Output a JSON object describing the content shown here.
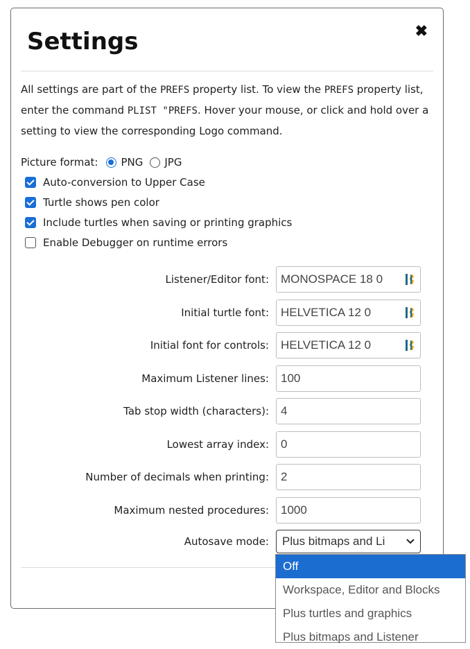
{
  "dialog": {
    "title": "Settings",
    "close": "✖"
  },
  "description": {
    "t1": "All settings are part of the ",
    "m1": "PREFS",
    "t2": " property list. To view the ",
    "m2": "PREFS",
    "t3": " property list, enter the command ",
    "m3": "PLIST \"PREFS",
    "t4": ". Hover your mouse, or click and hold over a setting to view the corresponding Logo command."
  },
  "picture_format": {
    "label": "Picture format:",
    "options": [
      "PNG",
      "JPG"
    ],
    "selected": "PNG"
  },
  "checkboxes": [
    {
      "label": "Auto-conversion to Upper Case",
      "checked": true
    },
    {
      "label": "Turtle shows pen color",
      "checked": true
    },
    {
      "label": "Include turtles when saving or printing graphics",
      "checked": true
    },
    {
      "label": "Enable Debugger on runtime errors",
      "checked": false
    }
  ],
  "fields": [
    {
      "label": "Listener/Editor font:",
      "value": "MONOSPACE 18 0",
      "icon": "font-picker-icon"
    },
    {
      "label": "Initial turtle font:",
      "value": "HELVETICA 12 0",
      "icon": "font-picker-icon"
    },
    {
      "label": "Initial font for controls:",
      "value": "HELVETICA 12 0",
      "icon": "font-picker-icon"
    },
    {
      "label": "Maximum Listener lines:",
      "value": "100"
    },
    {
      "label": "Tab stop width (characters):",
      "value": "4"
    },
    {
      "label": "Lowest array index:",
      "value": "0"
    },
    {
      "label": "Number of decimals when printing:",
      "value": "2"
    },
    {
      "label": "Maximum nested procedures:",
      "value": "1000"
    }
  ],
  "autosave": {
    "label": "Autosave mode:",
    "value": "Plus bitmaps and Li",
    "options": [
      "Off",
      "Workspace, Editor and Blocks",
      "Plus turtles and graphics",
      "Plus bitmaps and Listener"
    ],
    "highlighted": "Off"
  },
  "colors": {
    "accent": "#1a6fd6",
    "highlight": "#1c6dd0",
    "font_icon": "#1a6b8a"
  }
}
